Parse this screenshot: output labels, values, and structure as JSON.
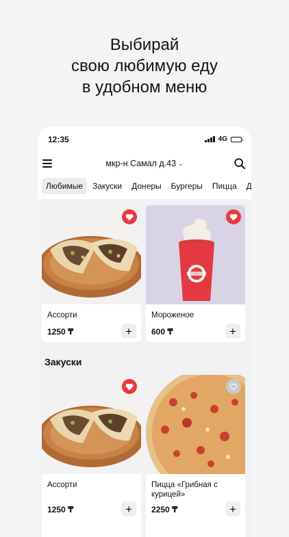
{
  "headline": {
    "line1": "Выбирай",
    "line2": "свою любимую еду",
    "line3": "в удобном меню"
  },
  "status_bar": {
    "time": "12:35",
    "network": "4G"
  },
  "header": {
    "address": "мкр-н Самал д.43"
  },
  "tabs": [
    {
      "label": "Любимые",
      "active": true
    },
    {
      "label": "Закуски"
    },
    {
      "label": "Донеры"
    },
    {
      "label": "Бургеры"
    },
    {
      "label": "Пицца"
    },
    {
      "label": "Де"
    }
  ],
  "favorites": [
    {
      "name": "Ассорти",
      "price": "1250 ₸",
      "favorite": true
    },
    {
      "name": "Мороженое",
      "price": "600 ₸",
      "favorite": true
    }
  ],
  "sections": [
    {
      "title": "Закуски",
      "items": [
        {
          "name": "Ассорти",
          "price": "1250 ₸",
          "favorite": true
        },
        {
          "name": "Пицца «Грибная с курицей»",
          "price": "2250 ₸",
          "favorite": false
        }
      ]
    }
  ],
  "add_label": "+",
  "colors": {
    "favorite_active": "#e8393e",
    "favorite_inactive": "#c9c9c9",
    "background": "#f4f4f4"
  }
}
